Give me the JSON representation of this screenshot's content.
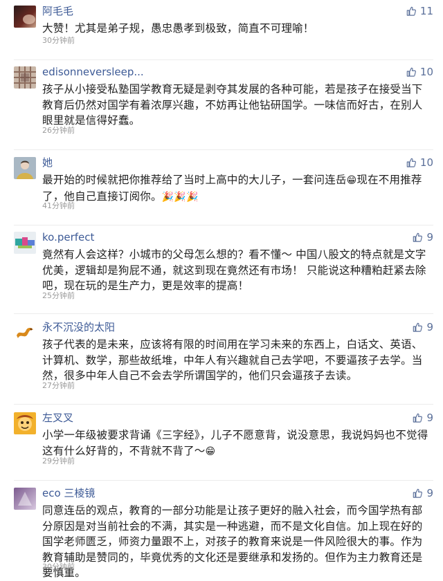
{
  "comments": [
    {
      "name": "阿毛毛",
      "likes": "11",
      "text": "大赞！尤其是弟子规，愚忠愚孝到极致，简直不可理喻！",
      "time": "30分钟前",
      "avatar": "avatar-dark-gradient"
    },
    {
      "name": "edisonneversleep...",
      "likes": "10",
      "text": "孩子从小接受私塾国学教育无疑是剥夺其发展的各种可能，若是孩子在接受当下教育后仍然对国学有着浓厚兴趣，不妨再让他钻研国学。一味信而好古，在别人眼里就是信得好蠢。",
      "time": "26分钟前",
      "avatar": "avatar-pattern"
    },
    {
      "name": "她",
      "likes": "10",
      "text_before_emoji": "最开始的时候就把你推荐给了当时上高中的大儿子，一套问连岳",
      "emoji1": "😁",
      "text_after_emoji": "现在不用推荐了，他自己直接订阅你。",
      "emoji2": "🎉🎉🎉",
      "time": "41分钟前",
      "avatar": "avatar-portrait"
    },
    {
      "name": "ko.perfect",
      "likes": "9",
      "text": "竟然有人会这样？小城市的父母怎么想的？看不懂～    中国八股文的特点就是文字优美，逻辑却是狗屁不通，就这到现在竟然还有市场！  只能说这种糟粕赶紧去除吧，现在玩的是生产力，更是效率的提高！",
      "time": "25分钟前",
      "avatar": "avatar-colorful"
    },
    {
      "name": "永不沉没的太阳",
      "likes": "9",
      "text": "孩子代表的是未来，应该将有限的时间用在学习未来的东西上，白话文、英语、计算机、数学，那些故纸堆，中年人有兴趣就自己去学吧，不要逼孩子去学。当然，很多中年人自己不会去学所谓国学的，他们只会逼孩子去读。",
      "time": "27分钟前",
      "avatar": "avatar-dragon"
    },
    {
      "name": "左叉叉",
      "likes": "9",
      "text_before_emoji": "小学一年级被要求背诵《三字经》，儿子不愿意背，说没意思，我说妈妈也不觉得这有什么好背的，不背就不背了～",
      "emoji1": "😁",
      "time": "29分钟前",
      "avatar": "avatar-cartoon"
    },
    {
      "name": "eco 三棱镜",
      "likes": "9",
      "text": "同意连岳的观点，教育的一部分功能是让孩子更好的融入社会，而今国学热有部分原因是对当前社会的不满，其实是一种逃避，而不是文化自信。加上现在好的国学老师匮乏，师资力量跟不上，对孩子的教育来说是一件风险很大的事。作为教育辅助是赞同的，毕竟优秀的文化还是要继承和发扬的。但作为主力教育还是要慎重。",
      "time": "30分钟前",
      "avatar": "avatar-purple"
    }
  ],
  "colors": {
    "name": "#3d5a96",
    "like": "#5a6f99",
    "time": "#9a9a9a",
    "text": "#222222"
  },
  "icons": {
    "like": "thumbs-up-icon"
  }
}
